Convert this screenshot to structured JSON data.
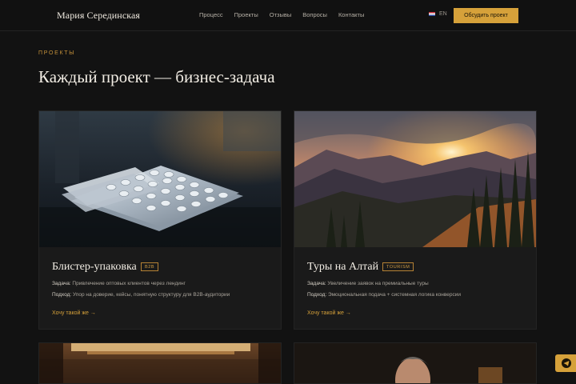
{
  "header": {
    "brand": "Мария Серединская",
    "nav": [
      "Процесс",
      "Проекты",
      "Отзывы",
      "Вопросы",
      "Контакты"
    ],
    "lang": "EN",
    "cta": "Обсудить проект"
  },
  "section": {
    "kicker": "ПРОЕКТЫ",
    "title": "Каждый проект — бизнес-задача"
  },
  "cards": [
    {
      "name": "Блистер-упаковка",
      "badge": "B2B",
      "task_label": "Задача:",
      "task": " Привлечение оптовых клиентов через лендинг",
      "approach_label": "Подход:",
      "approach": " Упор на доверие, кейсы, понятную структуру для B2B-аудитории",
      "link": "Хочу такой же →"
    },
    {
      "name": "Туры на Алтай",
      "badge": "TOURISM",
      "task_label": "Задача:",
      "task": " Увеличение заявок на премиальные туры",
      "approach_label": "Подход:",
      "approach": " Эмоциональная подача + системная логика конверсии",
      "link": "Хочу такой же →"
    }
  ],
  "icons": {
    "flag": "flag-uk-icon",
    "telegram": "telegram-icon"
  },
  "colors": {
    "accent": "#d6a13a",
    "background": "#121212"
  }
}
